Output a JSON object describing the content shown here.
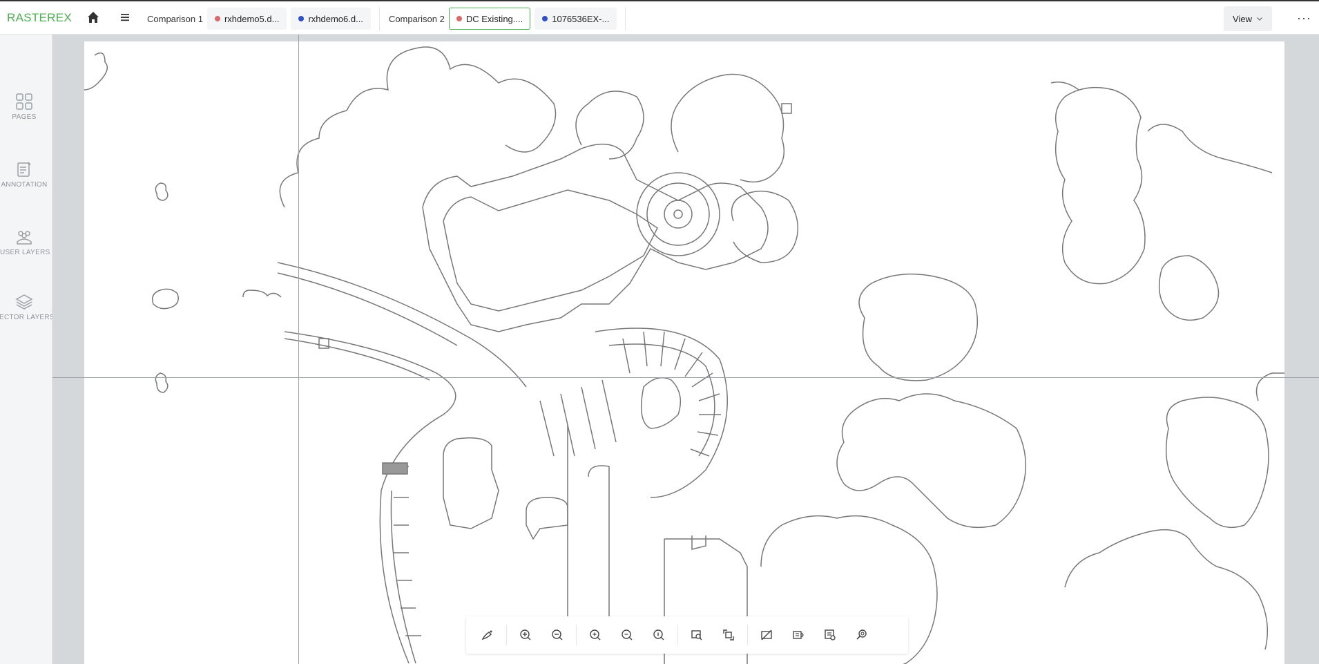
{
  "app": {
    "logo": "RASTEREX"
  },
  "header": {
    "groups": [
      {
        "label": "Comparison 1",
        "files": [
          {
            "name": "rxhdemo5.d...",
            "color": "#d9696b",
            "active": false
          },
          {
            "name": "rxhdemo6.d...",
            "color": "#2f50c8",
            "active": false
          }
        ]
      },
      {
        "label": "Comparison 2",
        "files": [
          {
            "name": "DC Existing....",
            "color": "#d9696b",
            "active": true
          },
          {
            "name": "1076536EX-...",
            "color": "#2f50c8",
            "active": false
          }
        ]
      }
    ],
    "view_label": "View",
    "more_label": "···"
  },
  "sidebar": {
    "items": [
      {
        "label": "PAGES",
        "icon": "pages-icon"
      },
      {
        "label": "ANNOTATION",
        "icon": "annotation-icon"
      },
      {
        "label": "USER LAYERS",
        "icon": "user-layers-icon"
      },
      {
        "label": "VECTOR LAYERS",
        "icon": "vector-layers-icon"
      }
    ]
  },
  "toolbar": {
    "buttons": [
      "magic-tool-icon",
      "zoom-in-icon",
      "zoom-out-icon",
      "zoom-in-alt-icon",
      "zoom-out-alt-icon",
      "zoom-fit-icon",
      "zoom-window-icon",
      "rotate-icon",
      "hide-icon",
      "compare-icon",
      "measure-icon",
      "search-icon"
    ]
  },
  "colors": {
    "accent": "#4cb050",
    "red_dot": "#d9696b",
    "blue_dot": "#2f50c8"
  }
}
